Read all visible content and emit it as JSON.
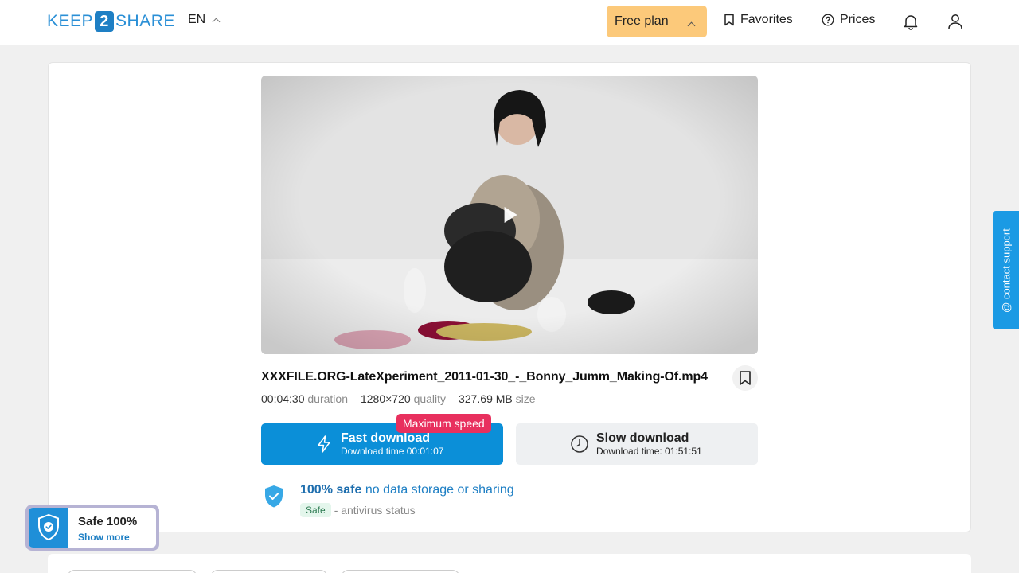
{
  "header": {
    "logo": {
      "left": "KEEP",
      "mid": "2",
      "right": "SHARE"
    },
    "lang": "EN",
    "free_plan": "Free plan",
    "favorites": "Favorites",
    "prices": "Prices"
  },
  "file": {
    "name": "XXXFILE.ORG-LateXperiment_2011-01-30_-_Bonny_Jumm_Making-Of.mp4",
    "duration_value": "00:04:30",
    "duration_label": "duration",
    "quality_value": "1280×720",
    "quality_label": "quality",
    "size_value": "327.69 MB",
    "size_label": "size"
  },
  "download": {
    "fast_label": "Fast download",
    "fast_time": "Download time 00:01:07",
    "max_speed": "Maximum speed",
    "slow_label": "Slow download",
    "slow_time": "Download time: 01:51:51"
  },
  "safety": {
    "title_bold": "100% safe",
    "title_rest": "no data storage or sharing",
    "status_pill": "Safe",
    "status_text": "- antivirus status"
  },
  "badge": {
    "title": "Safe 100%",
    "link": "Show more"
  },
  "support": {
    "label": "@ contact support"
  },
  "colors": {
    "brand": "#1e7fc4",
    "fast_button": "#0b8fd8",
    "max_speed": "#e8305e",
    "free_plan": "#fcc97a"
  }
}
